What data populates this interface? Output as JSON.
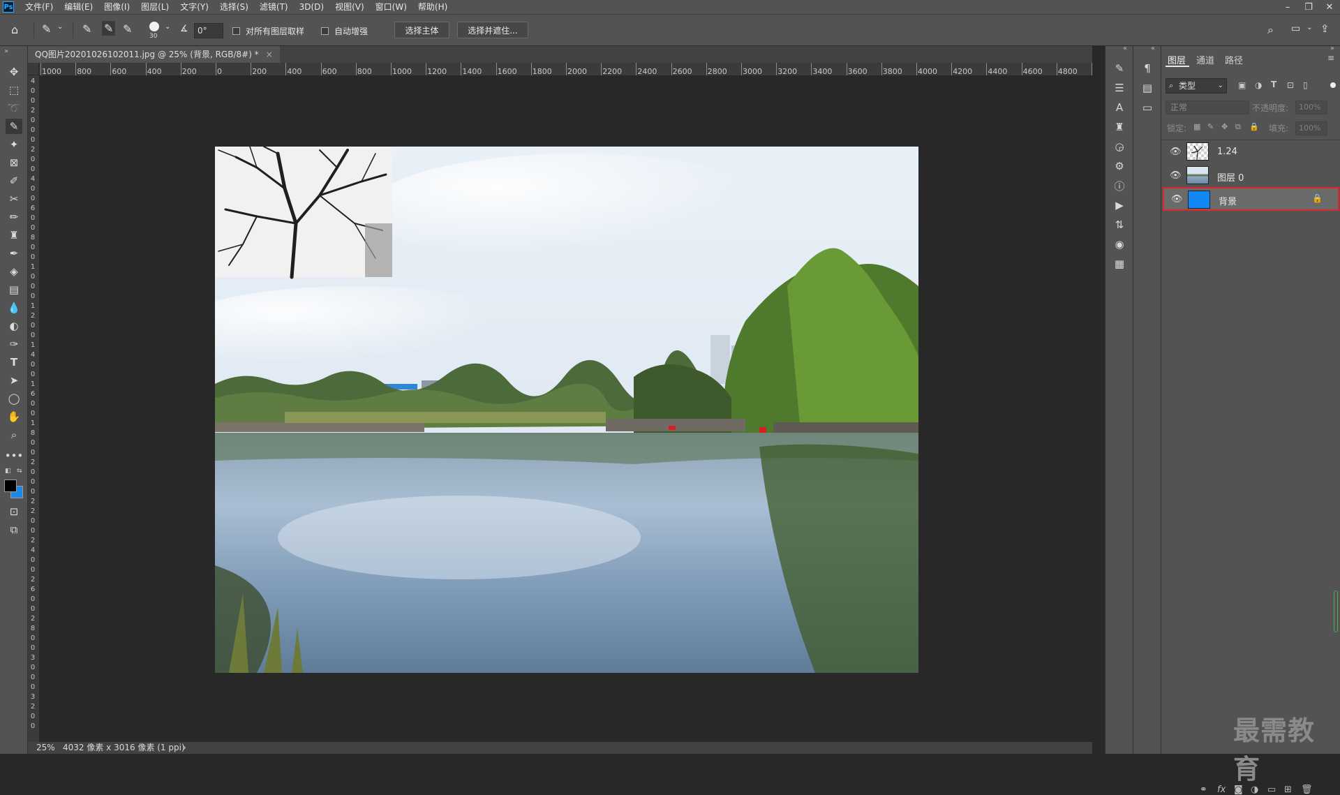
{
  "menu": [
    "文件(F)",
    "编辑(E)",
    "图像(I)",
    "图层(L)",
    "文字(Y)",
    "选择(S)",
    "滤镜(T)",
    "3D(D)",
    "视图(V)",
    "窗口(W)",
    "帮助(H)"
  ],
  "app_logo": "Ps",
  "window_controls": {
    "minimize": "–",
    "restore": "❐",
    "close": "✕"
  },
  "options": {
    "brush_size": "30",
    "angle_value": "0°",
    "sample_all_layers": "对所有图层取样",
    "auto_enhance": "自动增强",
    "select_subject": "选择主体",
    "select_and_mask": "选择并遮住..."
  },
  "document_tab": {
    "title": "QQ图片20201026102011.jpg @ 25% (背景, RGB/8#) *",
    "close": "×"
  },
  "ruler_h": [
    "1000",
    "800",
    "600",
    "400",
    "200",
    "0",
    "200",
    "400",
    "600",
    "800",
    "1000",
    "1200",
    "1400",
    "1600",
    "1800",
    "2000",
    "2200",
    "2400",
    "2600",
    "2800",
    "3000",
    "3200",
    "3400",
    "3600",
    "3800",
    "4000",
    "4200",
    "4400",
    "4600",
    "4800",
    "5"
  ],
  "ruler_v": [
    "4",
    "0",
    "0",
    "2",
    "0",
    "0",
    "0",
    "2",
    "0",
    "0",
    "4",
    "0",
    "0",
    "6",
    "0",
    "0",
    "8",
    "0",
    "0",
    "1",
    "0",
    "0",
    "0",
    "1",
    "2",
    "0",
    "0",
    "1",
    "4",
    "0",
    "0",
    "1",
    "6",
    "0",
    "0",
    "1",
    "8",
    "0",
    "0",
    "2",
    "0",
    "0",
    "0",
    "2",
    "2",
    "0",
    "0",
    "2",
    "4",
    "0",
    "0",
    "2",
    "6",
    "0",
    "0",
    "2",
    "8",
    "0",
    "0",
    "3",
    "0",
    "0",
    "0",
    "3",
    "2",
    "0",
    "0"
  ],
  "status": {
    "zoom": "25%",
    "dimensions": "4032 像素 x 3016 像素 (1 ppi)",
    "arrow": "›"
  },
  "layers_panel": {
    "tabs": [
      "图层",
      "通道",
      "路径"
    ],
    "filter_kind": "类型",
    "blend_mode": "正常",
    "opacity_label": "不透明度:",
    "opacity_value": "100%",
    "lock_label": "锁定:",
    "fill_label": "填充:",
    "fill_value": "100%",
    "layers": [
      {
        "name": "1.24",
        "visible": true,
        "locked": false,
        "selected": false
      },
      {
        "name": "图层 0",
        "visible": true,
        "locked": false,
        "selected": false
      },
      {
        "name": "背景",
        "visible": true,
        "locked": true,
        "selected": true
      }
    ],
    "selection_highlight_color": "#e0252b",
    "background_thumb_color": "#1388f5"
  },
  "colors": {
    "foreground": "#000000",
    "background": "#1e88e5"
  },
  "watermark": "最需教育"
}
